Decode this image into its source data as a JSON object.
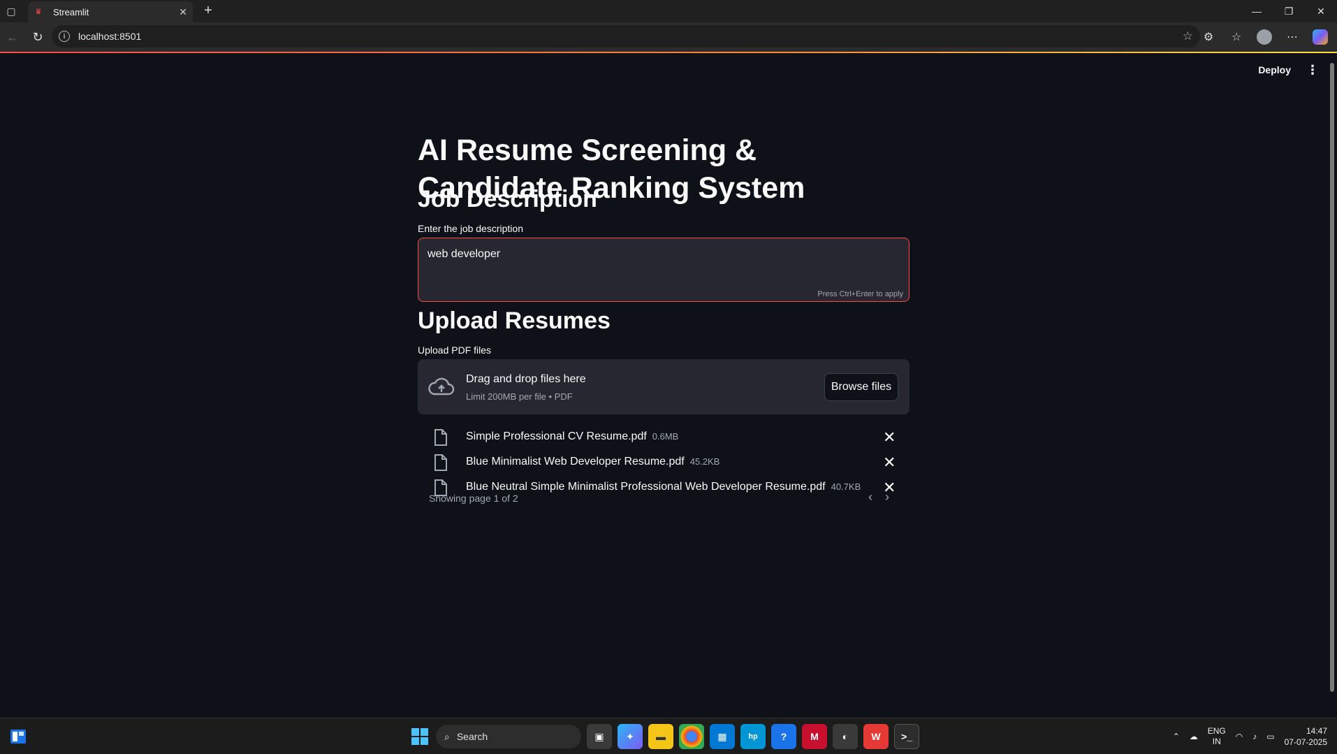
{
  "browser": {
    "tab_title": "Streamlit",
    "url": "localhost:8501"
  },
  "app": {
    "deploy_label": "Deploy",
    "title": "AI Resume Screening & Candidate Ranking System",
    "job_section": {
      "heading": "Job Description",
      "label": "Enter the job description",
      "value": "web developer",
      "hint": "Press Ctrl+Enter to apply"
    },
    "upload_section": {
      "heading": "Upload Resumes",
      "label": "Upload PDF files",
      "dropzone_title": "Drag and drop files here",
      "dropzone_sub": "Limit 200MB per file • PDF",
      "browse_label": "Browse files",
      "files": [
        {
          "name": "Simple Professional CV Resume.pdf",
          "size": "0.6MB"
        },
        {
          "name": "Blue Minimalist Web Developer Resume.pdf",
          "size": "45.2KB"
        },
        {
          "name": "Blue Neutral Simple Minimalist Professional Web Developer Resume.pdf",
          "size": "40.7KB"
        }
      ],
      "pagination": "Showing page 1 of 2"
    }
  },
  "taskbar": {
    "search_placeholder": "Search",
    "lang_top": "ENG",
    "lang_bottom": "IN",
    "time": "14:47",
    "date": "07-07-2025"
  },
  "colors": {
    "accent": "#ff4b4b",
    "background": "#0e1117",
    "widget_bg": "#262730"
  }
}
